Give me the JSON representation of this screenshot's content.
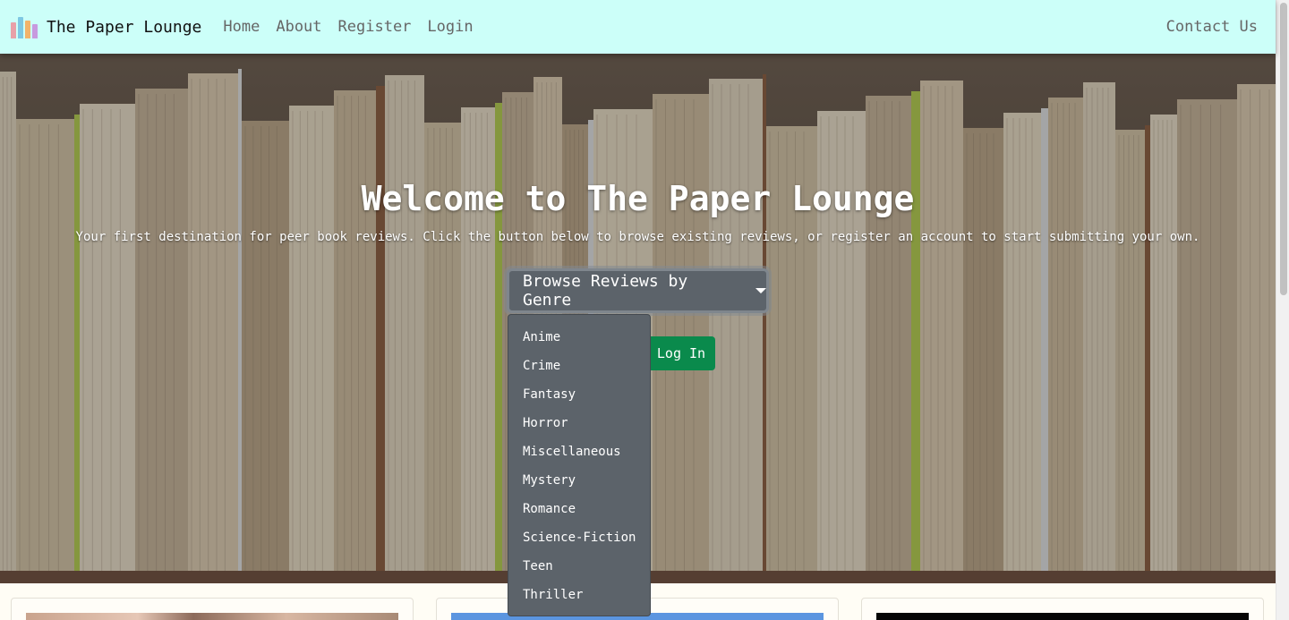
{
  "navbar": {
    "brand": "The Paper Lounge",
    "links": [
      "Home",
      "About",
      "Register",
      "Login"
    ],
    "contact": "Contact Us"
  },
  "hero": {
    "title": "Welcome to The Paper Lounge",
    "subtitle": "Your first destination for peer book reviews. Click the button below to browse existing reviews, or register an account to start submitting your own.",
    "dropdown_label": "Browse Reviews by Genre",
    "login_label": "Log In"
  },
  "genres": [
    "Anime",
    "Crime",
    "Fantasy",
    "Horror",
    "Miscellaneous",
    "Mystery",
    "Romance",
    "Science-Fiction",
    "Teen",
    "Thriller"
  ],
  "colors": {
    "navbar_bg": "#ccfff9",
    "dropdown_bg": "#5c636a",
    "login_bg": "#0a8a4c"
  },
  "icons": {
    "brand": "books-icon",
    "dropdown": "caret-down-icon"
  }
}
